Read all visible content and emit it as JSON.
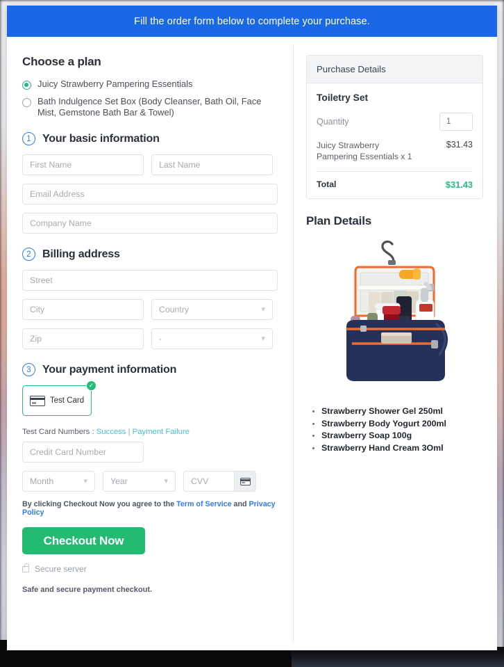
{
  "banner": {
    "text": "Fill the order form below to complete your purchase."
  },
  "plan": {
    "heading": "Choose a plan",
    "options": [
      {
        "label": "Juicy Strawberry Pampering Essentials",
        "selected": true
      },
      {
        "label": "Bath Indulgence Set Box (Body Cleanser, Bath Oil, Face Mist, Gemstone Bath Bar & Towel)",
        "selected": false
      }
    ]
  },
  "sections": {
    "basic": {
      "number": "1",
      "title": "Your basic information"
    },
    "billing": {
      "number": "2",
      "title": "Billing address"
    },
    "payment": {
      "number": "3",
      "title": "Your payment information"
    }
  },
  "fields": {
    "first_name": {
      "placeholder": "First Name",
      "value": ""
    },
    "last_name": {
      "placeholder": "Last Name",
      "value": ""
    },
    "email": {
      "placeholder": "Email Address",
      "value": ""
    },
    "company": {
      "placeholder": "Company Name",
      "value": ""
    },
    "street": {
      "placeholder": "Street",
      "value": ""
    },
    "city": {
      "placeholder": "City",
      "value": ""
    },
    "country": {
      "placeholder": "Country",
      "value": ""
    },
    "zip": {
      "placeholder": "Zip",
      "value": ""
    },
    "state": {
      "placeholder": "-",
      "value": ""
    },
    "credit_card": {
      "placeholder": "Credit Card Number",
      "value": ""
    },
    "month": {
      "placeholder": "Month",
      "value": ""
    },
    "year": {
      "placeholder": "Year",
      "value": ""
    },
    "cvv": {
      "placeholder": "CVV",
      "value": ""
    }
  },
  "payment": {
    "method_label": "Test  Card",
    "method_selected": true,
    "test_numbers_label": "Test Card Numbers :",
    "link_success": "Success",
    "separator": "|",
    "link_failure": "Payment Failure",
    "terms_prefix": "By clicking Checkout Now you agree to the",
    "terms_link": "Term of Service",
    "terms_and": "and",
    "privacy_link": "Privacy Policy",
    "checkout_label": "Checkout Now",
    "secure_server": "Secure server",
    "safe_note": "Safe and secure payment checkout."
  },
  "purchase": {
    "panel_title": "Purchase Details",
    "product_title": "Toiletry Set",
    "quantity_label": "Quantity",
    "quantity_value": "1",
    "line_item_name": "Juicy Strawberry Pampering Essentials x 1",
    "line_item_price": "$31.43",
    "total_label": "Total",
    "total_value": "$31.43"
  },
  "plan_details": {
    "title": "Plan Details",
    "items": [
      "Strawberry Shower Gel 250ml",
      "Strawberry Body Yogurt 200ml",
      "Strawberry Soap 100g",
      "Strawberry Hand Cream 3Oml"
    ]
  },
  "colors": {
    "banner_blue": "#1a68e5",
    "accent_green": "#23bb72",
    "link_blue": "#2f7bef",
    "link_teal": "#45c3cd",
    "step_blue": "#2f7bef"
  }
}
